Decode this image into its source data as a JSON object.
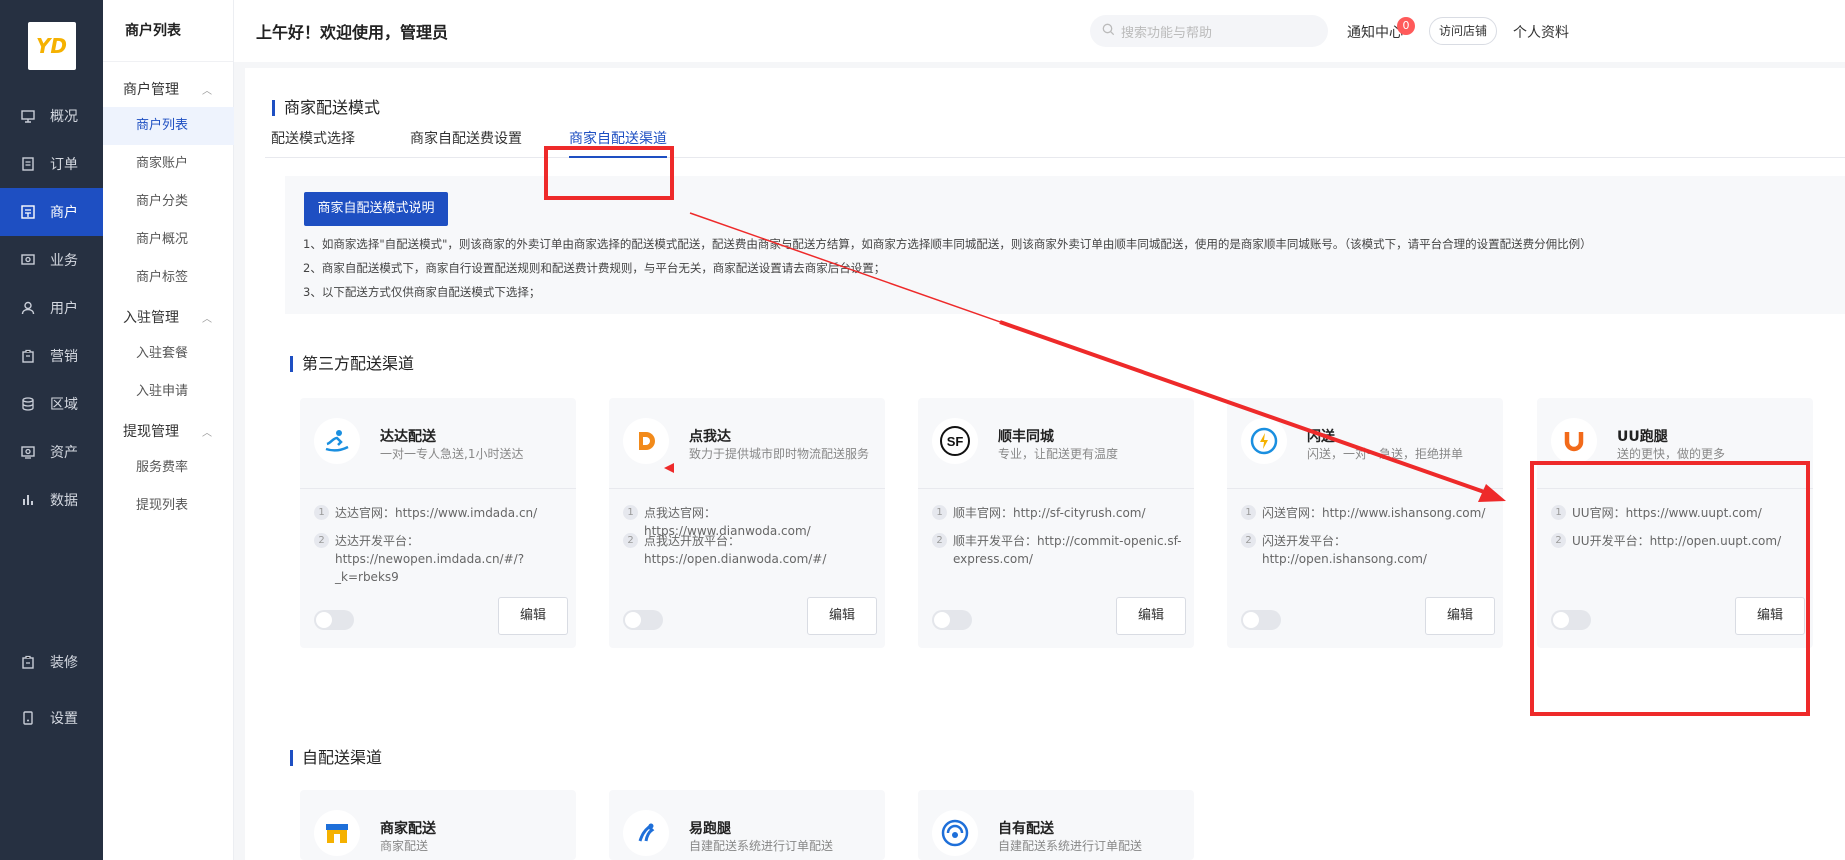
{
  "logo_text": "YD",
  "nav": [
    {
      "label": "概况",
      "icon": "monitor-icon"
    },
    {
      "label": "订单",
      "icon": "order-icon"
    },
    {
      "label": "商户",
      "icon": "store-icon",
      "active": true
    },
    {
      "label": "业务",
      "icon": "business-icon"
    },
    {
      "label": "用户",
      "icon": "user-icon"
    },
    {
      "label": "营销",
      "icon": "marketing-icon"
    },
    {
      "label": "区域",
      "icon": "region-icon"
    },
    {
      "label": "资产",
      "icon": "asset-icon"
    },
    {
      "label": "数据",
      "icon": "chart-icon"
    },
    {
      "label": "装修",
      "icon": "decorate-icon"
    },
    {
      "label": "设置",
      "icon": "settings-icon"
    }
  ],
  "subnav": {
    "title": "商户列表",
    "groups": [
      {
        "label": "商户管理",
        "items": [
          "商户列表",
          "商家账户",
          "商户分类",
          "商户概况",
          "商户标签"
        ]
      },
      {
        "label": "入驻管理",
        "items": [
          "入驻套餐",
          "入驻申请"
        ]
      },
      {
        "label": "提现管理",
        "items": [
          "服务费率",
          "提现列表"
        ]
      }
    ]
  },
  "header": {
    "greeting": "上午好！欢迎使用，管理员",
    "search_placeholder": "搜索功能与帮助",
    "notice_label": "通知中心",
    "notice_count": "0",
    "visit_label": "访问店铺",
    "profile_label": "个人资料"
  },
  "main": {
    "title": "商家配送模式",
    "tabs": [
      "配送模式选择",
      "商家自配送费设置",
      "商家自配送渠道"
    ],
    "info_button": "商家自配送模式说明",
    "notes": [
      "1、如商家选择\"自配送模式\"，则该商家的外卖订单由商家选择的配送模式配送，配送费由商家与配送方结算，如商家方选择顺丰同城配送，则该商家外卖订单由顺丰同城配送，使用的是商家顺丰同城账号。（该模式下，请平台合理的设置配送费分佣比例）",
      "2、商家自配送模式下，商家自行设置配送规则和配送费计费规则，与平台无关，商家配送设置请去商家后台设置；",
      "3、以下配送方式仅供商家自配送模式下选择；"
    ],
    "third_party_title": "第三方配送渠道",
    "self_title": "自配送渠道",
    "edit_label": "编辑",
    "third_party": [
      {
        "name": "达达配送",
        "desc": "一对一专人急送,1小时送达",
        "rows": [
          "达达官网：https://www.imdada.cn/",
          "达达开发平台：https://newopen.imdada.cn/#/?_k=rbeks9"
        ]
      },
      {
        "name": "点我达",
        "desc": "致力于提供城市即时物流配送服务",
        "rows": [
          "点我达官网：https://www.dianwoda.com/",
          "点我达开放平台：https://open.dianwoda.com/#/"
        ]
      },
      {
        "name": "顺丰同城",
        "desc": "专业，让配送更有温度",
        "rows": [
          "顺丰官网：http://sf-cityrush.com/",
          "顺丰开发平台：http://commit-openic.sf-express.com/"
        ]
      },
      {
        "name": "闪送",
        "desc": "闪送，一对一急送，拒绝拼单",
        "rows": [
          "闪送官网：http://www.ishansong.com/",
          "闪送开发平台：http://open.ishansong.com/"
        ]
      },
      {
        "name": "UU跑腿",
        "desc": "送的更快，做的更多",
        "rows": [
          "UU官网：https://www.uupt.com/",
          "UU开发平台：http://open.uupt.com/"
        ]
      }
    ],
    "self_channels": [
      {
        "name": "商家配送",
        "desc": "商家配送"
      },
      {
        "name": "易跑腿",
        "desc": "自建配送系统进行订单配送"
      },
      {
        "name": "自有配送",
        "desc": "自建配送系统进行订单配送"
      }
    ]
  },
  "colors": {
    "nav_bg": "#263041",
    "accent": "#1e4fc2",
    "annotation": "#ee2a2a"
  }
}
